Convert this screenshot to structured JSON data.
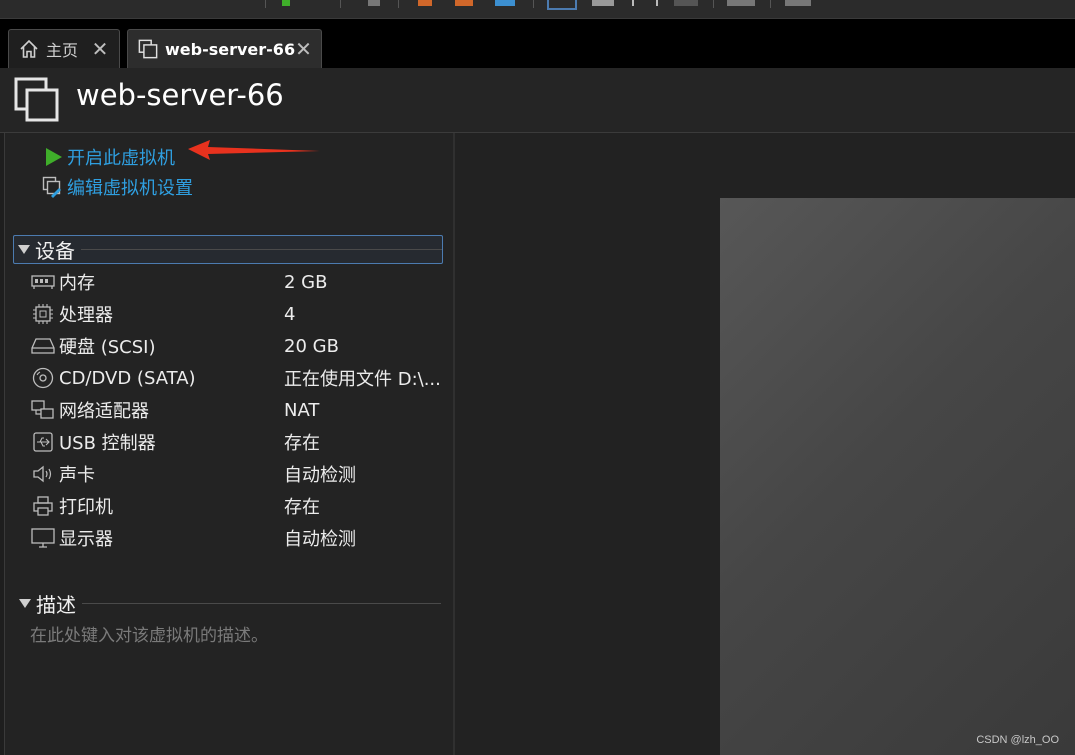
{
  "tabs": [
    {
      "label": "主页",
      "icon": "home-icon"
    },
    {
      "label": "web-server-66",
      "icon": "vm-icon"
    }
  ],
  "header": {
    "title": "web-server-66",
    "icon": "vm-icon"
  },
  "actions": {
    "start": "开启此虚拟机",
    "edit": "编辑虚拟机设置"
  },
  "devices_section": {
    "title": "设备"
  },
  "devices": [
    {
      "name": "内存",
      "value": "2 GB",
      "icon": "memory-icon"
    },
    {
      "name": "处理器",
      "value": "4",
      "icon": "cpu-icon"
    },
    {
      "name": "硬盘 (SCSI)",
      "value": "20 GB",
      "icon": "disk-icon"
    },
    {
      "name": "CD/DVD (SATA)",
      "value": "正在使用文件 D:\\...",
      "icon": "cd-icon"
    },
    {
      "name": "网络适配器",
      "value": "NAT",
      "icon": "network-icon"
    },
    {
      "name": "USB 控制器",
      "value": "存在",
      "icon": "usb-icon"
    },
    {
      "name": "声卡",
      "value": "自动检测",
      "icon": "sound-icon"
    },
    {
      "name": "打印机",
      "value": "存在",
      "icon": "printer-icon"
    },
    {
      "name": "显示器",
      "value": "自动检测",
      "icon": "display-icon"
    }
  ],
  "description_section": {
    "title": "描述",
    "placeholder": "在此处键入对该虚拟机的描述。"
  },
  "watermark": "CSDN @lzh_OO",
  "colors": {
    "link": "#2f9fe0",
    "play": "#3fae2a",
    "arrow": "#e8321e",
    "selection_border": "#4c7bb0"
  }
}
